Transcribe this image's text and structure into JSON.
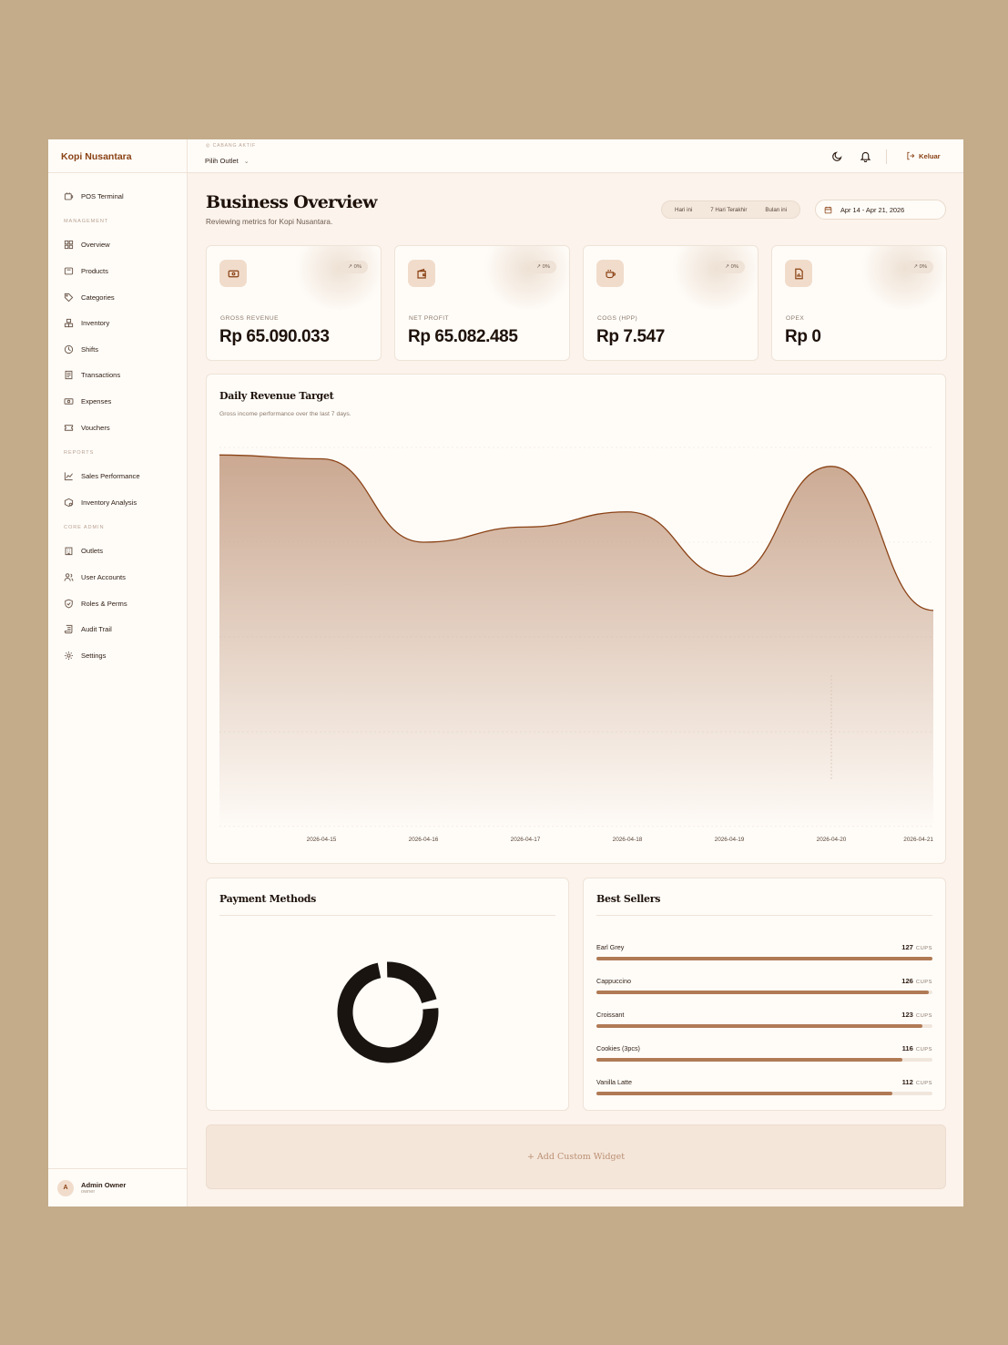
{
  "app": {
    "brand": "Kopi Nusantara"
  },
  "sidebar": {
    "top_items": [
      {
        "label": "POS Terminal",
        "icon": "pos-terminal-icon"
      }
    ],
    "sections": [
      {
        "title": "MANAGEMENT",
        "items": [
          {
            "label": "Overview",
            "icon": "grid-icon"
          },
          {
            "label": "Products",
            "icon": "box-icon"
          },
          {
            "label": "Categories",
            "icon": "tag-icon"
          },
          {
            "label": "Inventory",
            "icon": "boxes-icon"
          },
          {
            "label": "Shifts",
            "icon": "clock-icon"
          },
          {
            "label": "Transactions",
            "icon": "receipt-icon"
          },
          {
            "label": "Expenses",
            "icon": "banknote-icon"
          },
          {
            "label": "Vouchers",
            "icon": "ticket-icon"
          }
        ]
      },
      {
        "title": "REPORTS",
        "items": [
          {
            "label": "Sales Performance",
            "icon": "line-chart-icon"
          },
          {
            "label": "Inventory Analysis",
            "icon": "package-search-icon"
          }
        ]
      },
      {
        "title": "CORE ADMIN",
        "items": [
          {
            "label": "Outlets",
            "icon": "building-icon"
          },
          {
            "label": "User Accounts",
            "icon": "users-icon"
          },
          {
            "label": "Roles & Perms",
            "icon": "shield-icon"
          },
          {
            "label": "Audit Trail",
            "icon": "scroll-icon"
          },
          {
            "label": "Settings",
            "icon": "gear-icon"
          }
        ]
      }
    ],
    "user": {
      "initial": "A",
      "name": "Admin Owner",
      "role": "owner"
    }
  },
  "topbar": {
    "branch_label": "CABANG AKTIF",
    "branch_select": "Pilih Outlet",
    "logout_label": "Keluar",
    "icons": [
      "moon-icon",
      "bell-icon",
      "logout-icon"
    ]
  },
  "header": {
    "title": "Business Overview",
    "subtitle": "Reviewing metrics for Kopi Nusantara.",
    "range_tabs": [
      "Hari ini",
      "7 Hari Terakhir",
      "Bulan ini"
    ],
    "date_range": "Apr 14 - Apr 21, 2026"
  },
  "kpis": [
    {
      "label": "GROSS REVENUE",
      "value": "Rp 65.090.033",
      "change": "0%",
      "icon": "money-icon"
    },
    {
      "label": "NET PROFIT",
      "value": "Rp 65.082.485",
      "change": "0%",
      "icon": "wallet-icon"
    },
    {
      "label": "COGS (HPP)",
      "value": "Rp 7.547",
      "change": "0%",
      "icon": "coffee-icon"
    },
    {
      "label": "OPEX",
      "value": "Rp 0",
      "change": "0%",
      "icon": "report-icon"
    }
  ],
  "revenue_panel": {
    "title": "Daily Revenue Target",
    "subtitle": "Gross income performance over the last 7 days."
  },
  "payment_panel": {
    "title": "Payment Methods"
  },
  "best_sellers": {
    "title": "Best Sellers",
    "unit": "CUPS",
    "items": [
      {
        "name": "Earl Grey",
        "count": 127,
        "fraction": 1.0
      },
      {
        "name": "Cappuccino",
        "count": 126,
        "fraction": 0.99
      },
      {
        "name": "Croissant",
        "count": 123,
        "fraction": 0.97
      },
      {
        "name": "Cookies (3pcs)",
        "count": 116,
        "fraction": 0.91
      },
      {
        "name": "Vanilla Latte",
        "count": 112,
        "fraction": 0.88
      }
    ]
  },
  "add_widget_label": "+ Add Custom Widget",
  "colors": {
    "accent": "#8a4215",
    "bar": "#b07a55",
    "area": "#c8a48c"
  },
  "chart_data": [
    {
      "type": "area",
      "title": "Daily Revenue Target",
      "x": [
        "2026-04-14",
        "2026-04-15",
        "2026-04-16",
        "2026-04-17",
        "2026-04-18",
        "2026-04-19",
        "2026-04-20",
        "2026-04-21"
      ],
      "x_tick_labels": [
        "2026-04-15",
        "2026-04-16",
        "2026-04-17",
        "2026-04-18",
        "2026-04-19",
        "2026-04-20",
        "2026-04-21"
      ],
      "values": [
        9.8,
        9.7,
        7.5,
        7.9,
        8.3,
        6.6,
        9.5,
        5.7
      ],
      "ylim": [
        0,
        10
      ],
      "grid": true
    },
    {
      "type": "pie",
      "title": "Payment Methods",
      "values": [
        100
      ]
    }
  ]
}
